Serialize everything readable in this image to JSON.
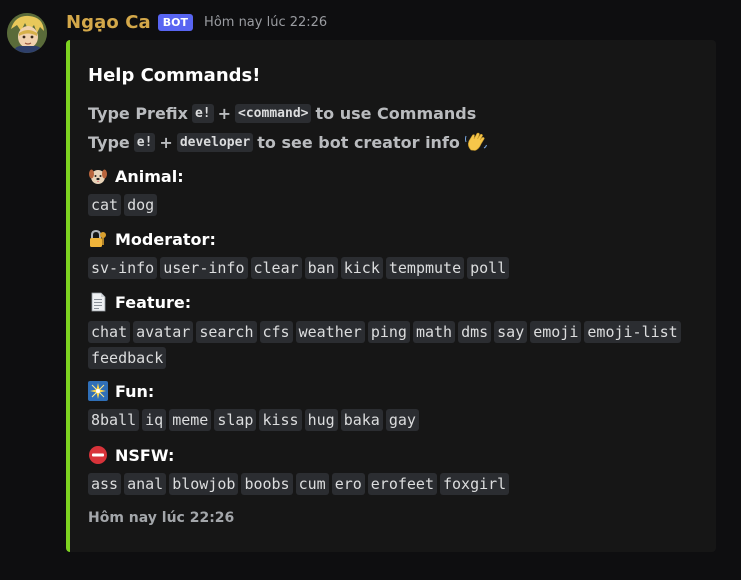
{
  "message": {
    "username": "Ngạo Ca",
    "badge": "BOT",
    "timestamp": "Hôm nay lúc 22:26"
  },
  "embed": {
    "accent_color": "#7ed321",
    "title": "Help Commands!",
    "line1": {
      "before": "Type Prefix",
      "code1": "e!",
      "plus": "+",
      "code2": "<command>",
      "after": "to use Commands"
    },
    "line2": {
      "before": "Type",
      "code1": "e!",
      "plus": "+",
      "code2": "developer",
      "after": "to see bot creator info"
    },
    "fields": [
      {
        "name": "Animal:",
        "icon": "dog-face-icon",
        "commands": [
          "cat",
          "dog"
        ]
      },
      {
        "name": "Moderator:",
        "icon": "lock-with-key-icon",
        "commands": [
          "sv-info",
          "user-info",
          "clear",
          "ban",
          "kick",
          "tempmute",
          "poll"
        ]
      },
      {
        "name": "Feature:",
        "icon": "page-facing-up-icon",
        "commands": [
          "chat",
          "avatar",
          "search",
          "cfs",
          "weather",
          "ping",
          "math",
          "dms",
          "say",
          "emoji",
          "emoji-list",
          "feedback"
        ]
      },
      {
        "name": "Fun:",
        "icon": "sparkle-burst-icon",
        "commands": [
          "8ball",
          "iq",
          "meme",
          "slap",
          "kiss",
          "hug",
          "baka",
          "gay"
        ]
      },
      {
        "name": "NSFW:",
        "icon": "no-entry-icon",
        "commands": [
          "ass",
          "anal",
          "blowjob",
          "boobs",
          "cum",
          "ero",
          "erofeet",
          "foxgirl"
        ]
      }
    ],
    "footer": "Hôm nay lúc 22:26"
  }
}
